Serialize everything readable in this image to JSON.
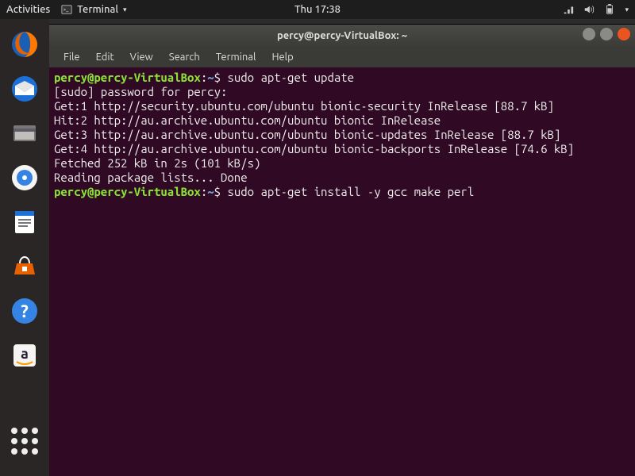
{
  "topbar": {
    "activities": "Activities",
    "app_name": "Terminal",
    "clock": "Thu 17:38"
  },
  "launcher": {
    "items": [
      {
        "name": "firefox",
        "tooltip": "Firefox"
      },
      {
        "name": "thunderbird",
        "tooltip": "Thunderbird"
      },
      {
        "name": "files",
        "tooltip": "Files"
      },
      {
        "name": "rhythmbox",
        "tooltip": "Rhythmbox"
      },
      {
        "name": "writer",
        "tooltip": "LibreOffice Writer"
      },
      {
        "name": "software",
        "tooltip": "Ubuntu Software"
      },
      {
        "name": "help",
        "tooltip": "Help"
      },
      {
        "name": "amazon",
        "tooltip": "Amazon"
      }
    ],
    "apps_label": "Show Applications"
  },
  "window": {
    "title": "percy@percy-VirtualBox: ~",
    "menu": [
      "File",
      "Edit",
      "View",
      "Search",
      "Terminal",
      "Help"
    ]
  },
  "terminal": {
    "prompt_user": "percy@percy-VirtualBox",
    "prompt_sep": ":",
    "prompt_path": "~",
    "prompt_sym": "$",
    "lines": [
      {
        "type": "cmd",
        "text": "sudo apt-get update"
      },
      {
        "type": "out",
        "text": "[sudo] password for percy:"
      },
      {
        "type": "out",
        "text": "Get:1 http://security.ubuntu.com/ubuntu bionic-security InRelease [88.7 kB]"
      },
      {
        "type": "out",
        "text": "Hit:2 http://au.archive.ubuntu.com/ubuntu bionic InRelease"
      },
      {
        "type": "out",
        "text": "Get:3 http://au.archive.ubuntu.com/ubuntu bionic-updates InRelease [88.7 kB]"
      },
      {
        "type": "out",
        "text": "Get:4 http://au.archive.ubuntu.com/ubuntu bionic-backports InRelease [74.6 kB]"
      },
      {
        "type": "out",
        "text": "Fetched 252 kB in 2s (101 kB/s)"
      },
      {
        "type": "out",
        "text": "Reading package lists... Done"
      },
      {
        "type": "cmd",
        "text": "sudo apt-get install -y gcc make perl"
      }
    ]
  }
}
